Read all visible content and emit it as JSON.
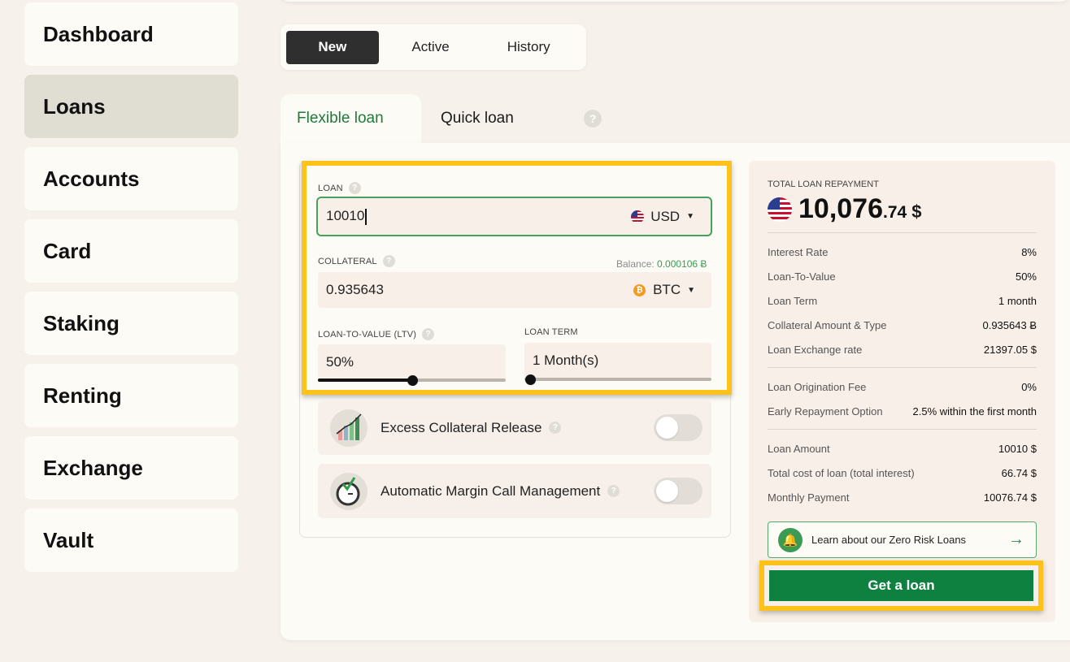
{
  "sidebar": {
    "items": [
      {
        "label": "Dashboard"
      },
      {
        "label": "Loans"
      },
      {
        "label": "Accounts"
      },
      {
        "label": "Card"
      },
      {
        "label": "Staking"
      },
      {
        "label": "Renting"
      },
      {
        "label": "Exchange"
      },
      {
        "label": "Vault"
      }
    ],
    "active": "Loans"
  },
  "segment_tabs": {
    "new": "New",
    "active": "Active",
    "history": "History",
    "selected": "New"
  },
  "loan_tabs": {
    "flexible": "Flexible loan",
    "quick": "Quick loan",
    "help": "?"
  },
  "form": {
    "loan": {
      "label": "LOAN",
      "value": "10010",
      "currency": "USD"
    },
    "collateral": {
      "label": "COLLATERAL",
      "balance_label": "Balance:",
      "balance_value": "0.000106 Ƀ",
      "value": "0.935643",
      "currency": "BTC"
    },
    "ltv": {
      "label": "LOAN-TO-VALUE (LTV)",
      "value": "50%",
      "slider_fraction": 0.5
    },
    "term": {
      "label": "LOAN TERM",
      "value": "1 Month(s)",
      "slider_fraction": 0.0
    },
    "help": "?"
  },
  "options": [
    {
      "label": "Excess Collateral Release",
      "enabled": false
    },
    {
      "label": "Automatic Margin Call Management",
      "enabled": false
    }
  ],
  "summary": {
    "title": "TOTAL LOAN REPAYMENT",
    "total_main": "10,076",
    "total_cents": ".74",
    "total_currency": "$",
    "rows": [
      {
        "label": "Interest Rate",
        "value": "8%"
      },
      {
        "label": "Loan-To-Value",
        "value": "50%"
      },
      {
        "label": "Loan Term",
        "value": "1 month"
      },
      {
        "label": "Collateral Amount & Type",
        "value": "0.935643 Ƀ"
      },
      {
        "label": "Loan Exchange rate",
        "value": "21397.05 $"
      },
      {
        "label": "Loan Origination Fee",
        "value": "0%"
      },
      {
        "label": "Early Repayment Option",
        "value": "2.5% within the first month"
      },
      {
        "label": "Loan Amount",
        "value": "10010 $"
      },
      {
        "label": "Total cost of loan (total interest)",
        "value": "66.74 $"
      },
      {
        "label": "Monthly Payment",
        "value": "10076.74 $"
      }
    ],
    "learn_link": "Learn about our Zero Risk Loans",
    "cta": "Get a loan"
  },
  "colors": {
    "accent_green": "#0e8040",
    "highlight": "#ffc21a",
    "active_tab_text": "#1d7a3a"
  }
}
